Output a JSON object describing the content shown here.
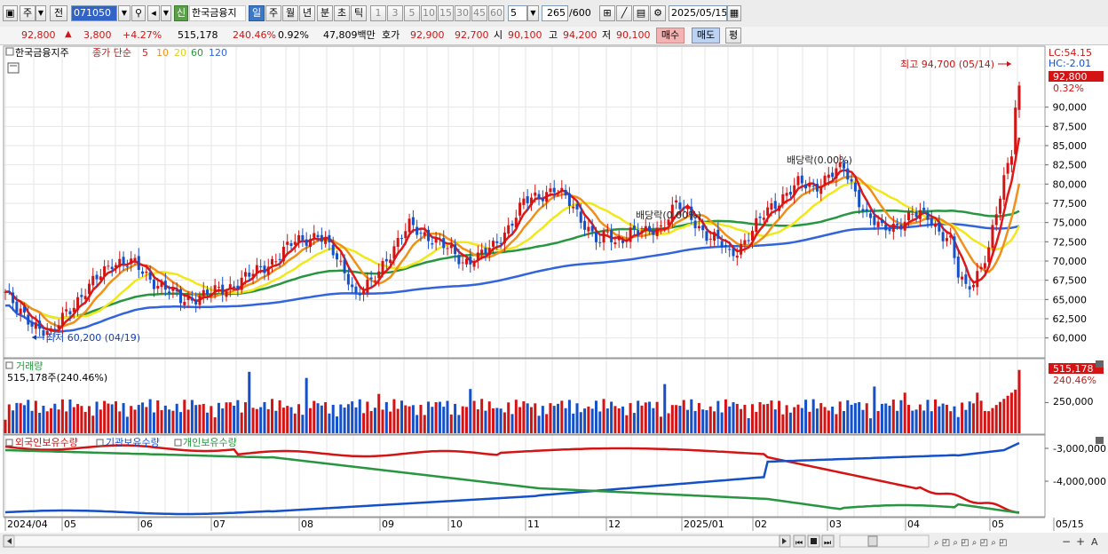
{
  "toolbar": {
    "period_label": "주",
    "prev_label": "전",
    "code": "071050",
    "new_badge": "신",
    "stock_name": "한국금융지",
    "periods": [
      "일",
      "주",
      "월",
      "년",
      "분",
      "초",
      "틱"
    ],
    "active_period": "일",
    "minute_options": [
      "1",
      "3",
      "5",
      "10",
      "15",
      "30",
      "45",
      "60"
    ],
    "minute_select": "5",
    "count": "265",
    "count_total": "/600",
    "date": "2025/05/15"
  },
  "quote": {
    "price": "92,800",
    "change": "3,800",
    "change_pct": "+4.27%",
    "volume": "515,178",
    "vol_pct": "240.46%",
    "turnover_pct": "0.92%",
    "amount": "47,809백만",
    "bid_label": "호가",
    "bid1": "92,900",
    "bid2": "92,700",
    "open_label": "시",
    "open": "90,100",
    "high_label": "고",
    "high": "94,200",
    "low_label": "저",
    "low": "90,100",
    "buy_label": "매수",
    "sell_label": "매도",
    "eval_label": "평"
  },
  "colors": {
    "up": "#d41414",
    "down": "#1450c8",
    "ma5": "#e01818",
    "ma10": "#f09018",
    "ma20": "#f0e818",
    "ma60": "#289640",
    "ma120": "#3264dc"
  },
  "chart_data": {
    "type": "candlestick",
    "title": "한국금융지주",
    "legend": {
      "label": "종가 단순",
      "periods": [
        "5",
        "10",
        "20",
        "60",
        "120"
      ]
    },
    "y_axis_labels": [
      "90,000",
      "87,500",
      "85,000",
      "82,500",
      "80,000",
      "77,500",
      "75,000",
      "72,500",
      "70,000",
      "67,500",
      "65,000",
      "62,500",
      "60,000"
    ],
    "ylim": [
      58000,
      97000
    ],
    "x_axis_labels": [
      "2024/04",
      "05",
      "06",
      "07",
      "08",
      "09",
      "10",
      "11",
      "12",
      "2025/01",
      "02",
      "03",
      "04",
      "05",
      "05/15"
    ],
    "price_path": [
      [
        0,
        66000
      ],
      [
        3,
        63500
      ],
      [
        8,
        61800
      ],
      [
        12,
        60200
      ],
      [
        16,
        63500
      ],
      [
        22,
        66500
      ],
      [
        28,
        70000
      ],
      [
        34,
        69500
      ],
      [
        40,
        67000
      ],
      [
        46,
        65000
      ],
      [
        52,
        65500
      ],
      [
        58,
        66500
      ],
      [
        64,
        68000
      ],
      [
        70,
        70000
      ],
      [
        76,
        72500
      ],
      [
        82,
        73500
      ],
      [
        86,
        71000
      ],
      [
        90,
        68000
      ],
      [
        92,
        65500
      ],
      [
        96,
        67000
      ],
      [
        100,
        70500
      ],
      [
        106,
        74500
      ],
      [
        112,
        73000
      ],
      [
        116,
        71500
      ],
      [
        120,
        70000
      ],
      [
        124,
        70500
      ],
      [
        128,
        71800
      ],
      [
        132,
        74500
      ],
      [
        136,
        77500
      ],
      [
        140,
        78500
      ],
      [
        144,
        79500
      ],
      [
        148,
        77500
      ],
      [
        152,
        75000
      ],
      [
        156,
        72200
      ],
      [
        158,
        73500
      ],
      [
        160,
        72300
      ],
      [
        164,
        74000
      ],
      [
        168,
        73500
      ],
      [
        172,
        74500
      ],
      [
        176,
        77500
      ],
      [
        180,
        75500
      ],
      [
        184,
        73500
      ],
      [
        186,
        73000
      ],
      [
        188,
        72000
      ],
      [
        190,
        70700
      ],
      [
        192,
        71500
      ],
      [
        196,
        74000
      ],
      [
        200,
        76500
      ],
      [
        204,
        78500
      ],
      [
        208,
        80000
      ],
      [
        212,
        79500
      ],
      [
        216,
        81200
      ],
      [
        220,
        82000
      ],
      [
        222,
        80000
      ],
      [
        226,
        76000
      ],
      [
        230,
        74000
      ],
      [
        234,
        74800
      ],
      [
        238,
        76000
      ],
      [
        242,
        75800
      ],
      [
        246,
        73500
      ],
      [
        248,
        72500
      ],
      [
        250,
        68000
      ],
      [
        252,
        66500
      ],
      [
        254,
        67500
      ],
      [
        256,
        69500
      ],
      [
        258,
        71500
      ],
      [
        260,
        76000
      ],
      [
        262,
        80500
      ],
      [
        264,
        84500
      ],
      [
        265,
        90500
      ],
      [
        266,
        92800
      ]
    ],
    "high": {
      "value": "94,700",
      "date": "05/14",
      "label": "최고 94,700 (05/14)"
    },
    "low": {
      "value": "60,200",
      "date": "04/19",
      "label": "최저 60,200 (04/19)"
    },
    "dividend_markers": [
      "배당락(0.00%)",
      "배당락(0.00%)"
    ],
    "current_price": "92,800",
    "current_change": "0.32%",
    "lc": "LC:54.15",
    "hc": "HC:-2.01",
    "volume_panel": {
      "title": "거래량",
      "label": "515,178주(240.46%)",
      "axis_label": "250,000",
      "current": "515,178",
      "current_pct": "240.46%",
      "ylim": [
        0,
        520000
      ]
    },
    "holdings_panel": {
      "series": [
        "외국인보유수량",
        "기관보유수량",
        "개인보유수량"
      ],
      "axis_labels": [
        "-3,000,000",
        "-4,000,000"
      ]
    }
  }
}
